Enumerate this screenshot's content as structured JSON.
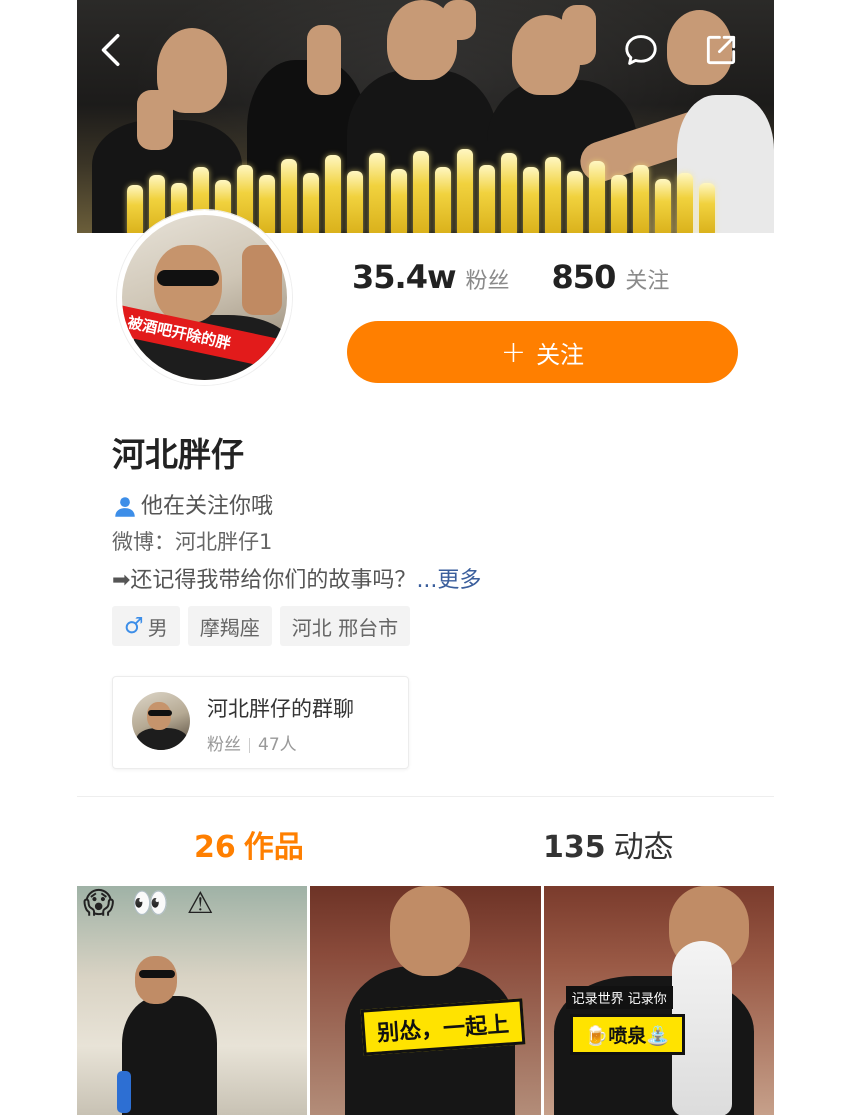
{
  "header": {
    "back_icon": "chevron-left-icon",
    "message_icon": "chat-bubble-icon",
    "share_icon": "share-out-icon"
  },
  "avatar": {
    "banner_text": "被酒吧开除的胖"
  },
  "stats": {
    "fans_value": "35.4w",
    "fans_label": "粉丝",
    "following_value": "850",
    "following_label": "关注"
  },
  "follow_button": {
    "plus": "+",
    "label": "关注"
  },
  "profile": {
    "name": "河北胖仔",
    "follows_you": "他在关注你哦",
    "weibo": "微博：河北胖仔1",
    "bio": "➡还记得我带给你们的故事吗？",
    "more": "...更多"
  },
  "tags": {
    "gender_symbol": "♂",
    "gender": "男",
    "zodiac": "摩羯座",
    "location": "河北 邢台市"
  },
  "group_chat": {
    "title": "河北胖仔的群聊",
    "role": "粉丝",
    "members": "47人"
  },
  "tabs": {
    "works_count": "26",
    "works_label": "作品",
    "moments_count": "135",
    "moments_label": "动态"
  },
  "videos": {
    "v1_emojis": "😱 👀 ⚠",
    "v2_caption": "别怂，一起上",
    "v3_subcaption": "记录世界 记录你",
    "v3_caption": "🍺喷泉⛲"
  },
  "colors": {
    "accent": "#ff7f00",
    "link": "#3a5e9c",
    "male": "#3d8ee8"
  }
}
